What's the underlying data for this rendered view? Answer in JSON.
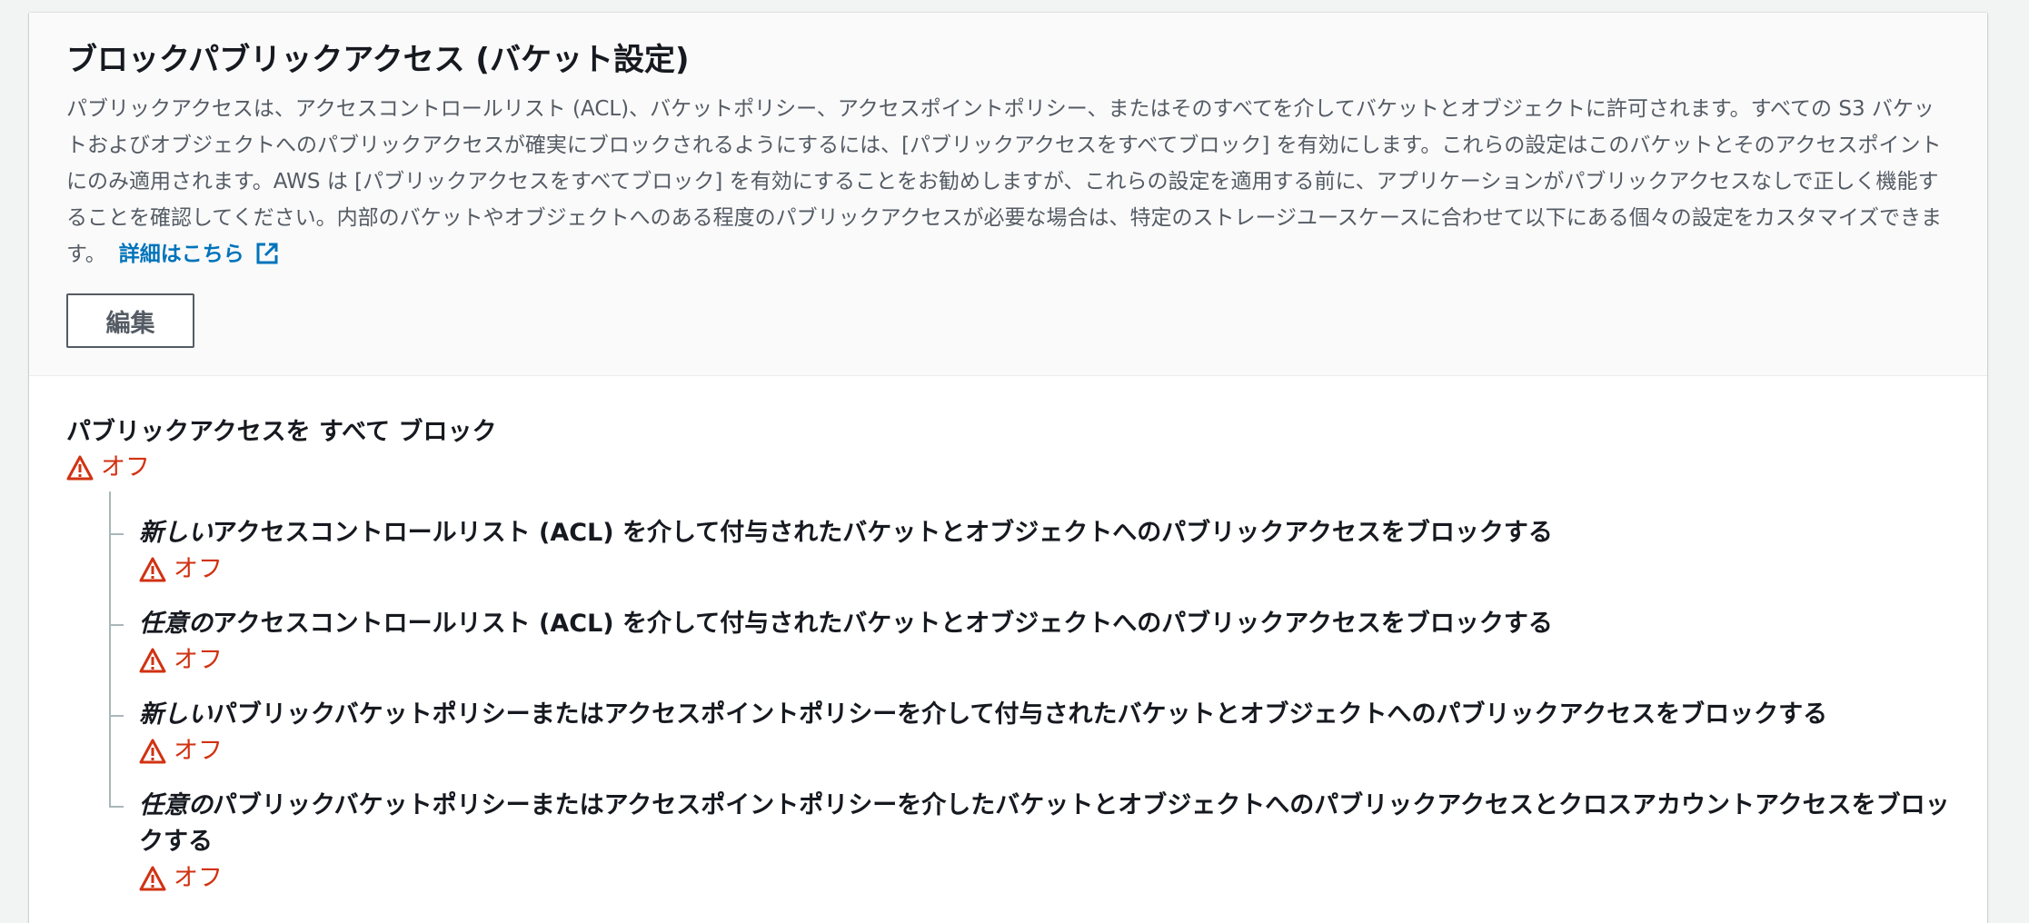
{
  "section": {
    "title": "ブロックパブリックアクセス (バケット設定)",
    "description": "パブリックアクセスは、アクセスコントロールリスト (ACL)、バケットポリシー、アクセスポイントポリシー、またはそのすべてを介してバケットとオブジェクトに許可されます。すべての S3 バケットおよびオブジェクトへのパブリックアクセスが確実にブロックされるようにするには、[パブリックアクセスをすべてブロック] を有効にします。これらの設定はこのバケットとそのアクセスポイントにのみ適用されます。AWS は [パブリックアクセスをすべてブロック] を有効にすることをお勧めしますが、これらの設定を適用する前に、アプリケーションがパブリックアクセスなしで正しく機能することを確認してください。内部のバケットやオブジェクトへのある程度のパブリックアクセスが必要な場合は、特定のストレージユースケースに合わせて以下にある個々の設定をカスタマイズできます。",
    "learn_more": "詳細はこちら",
    "learn_more_icon": "external-link-icon",
    "edit_label": "編集"
  },
  "block_all": {
    "label": "パブリックアクセスを すべて ブロック",
    "status": "オフ",
    "status_icon": "warning-icon"
  },
  "settings": [
    {
      "emphasis": "新しい",
      "label_rest": "アクセスコントロールリスト (ACL) を介して付与されたバケットとオブジェクトへのパブリックアクセスをブロックする",
      "status": "オフ"
    },
    {
      "emphasis": "任意の",
      "label_rest": "アクセスコントロールリスト (ACL) を介して付与されたバケットとオブジェクトへのパブリックアクセスをブロックする",
      "status": "オフ"
    },
    {
      "emphasis": "新しい",
      "label_rest": "パブリックバケットポリシーまたはアクセスポイントポリシーを介して付与されたバケットとオブジェクトへのパブリックアクセスをブロックする",
      "status": "オフ"
    },
    {
      "emphasis": "任意の",
      "label_rest": "パブリックバケットポリシーまたはアクセスポイントポリシーを介したバケットとオブジェクトへのパブリックアクセスとクロスアカウントアクセスをブロックする",
      "status": "オフ"
    }
  ],
  "colors": {
    "warning": "#d13212",
    "link": "#0073bb",
    "heading": "#16191f",
    "body_text": "#545b64"
  }
}
